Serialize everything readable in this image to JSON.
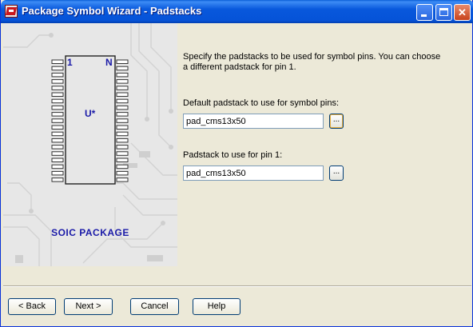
{
  "window": {
    "title": "Package Symbol Wizard - Padstacks",
    "controls": [
      "minimize-icon",
      "maximize-icon",
      "close-icon"
    ]
  },
  "graphic": {
    "pin_first": "1",
    "pin_last": "N",
    "ref_des": "U*",
    "package_label": "SOIC PACKAGE"
  },
  "content": {
    "instructions": "Specify the padstacks to be used for symbol pins. You can choose a different padstack for pin 1.",
    "default_label": "Default padstack to use for symbol pins:",
    "default_value": "pad_cms13x50",
    "pin1_label": "Padstack to use for pin 1:",
    "pin1_value": "pad_cms13x50",
    "browse_label": "..."
  },
  "buttons": {
    "back": "< Back",
    "next": "Next >",
    "cancel": "Cancel",
    "help": "Help"
  },
  "colors": {
    "titlebar": "#0653d8",
    "package_text": "#1a1aa8",
    "dialog_bg": "#ece9d8"
  }
}
